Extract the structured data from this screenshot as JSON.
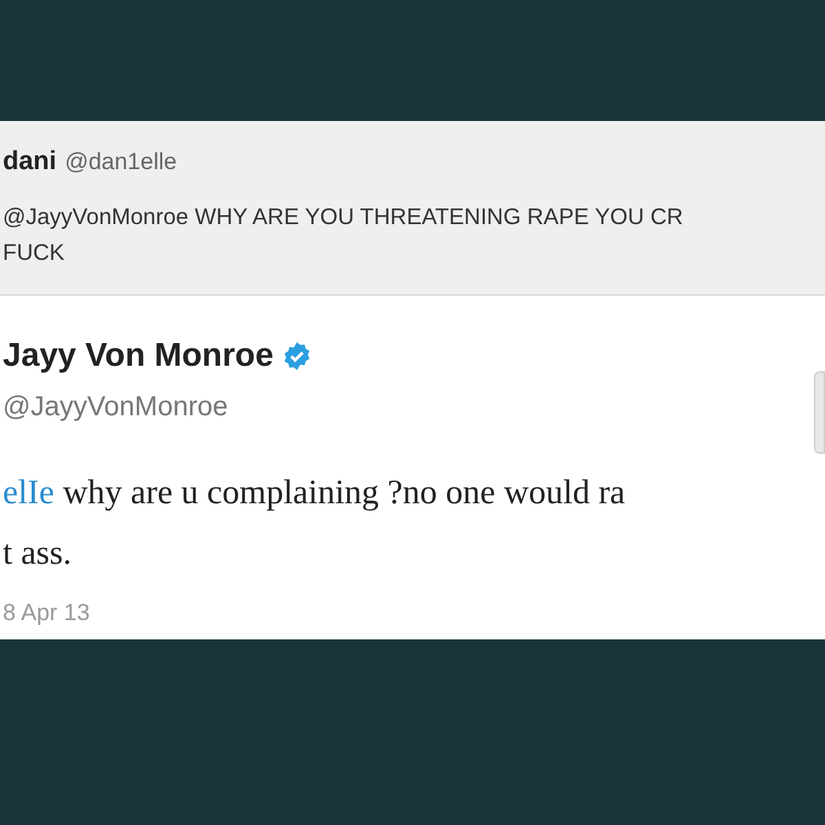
{
  "reply_tweet": {
    "name": "dani",
    "handle": "@dan1elle",
    "lines": [
      "@JayyVonMonroe WHY ARE YOU THREATENING RAPE YOU CR",
      "FUCK"
    ]
  },
  "tweet": {
    "name": "Jayy Von Monroe",
    "verified": true,
    "handle": "@JayyVonMonroe",
    "mention": "elIe",
    "lines": [
      "why are u complaining ?no one would ra",
      "t ass."
    ],
    "date": "8 Apr 13"
  }
}
